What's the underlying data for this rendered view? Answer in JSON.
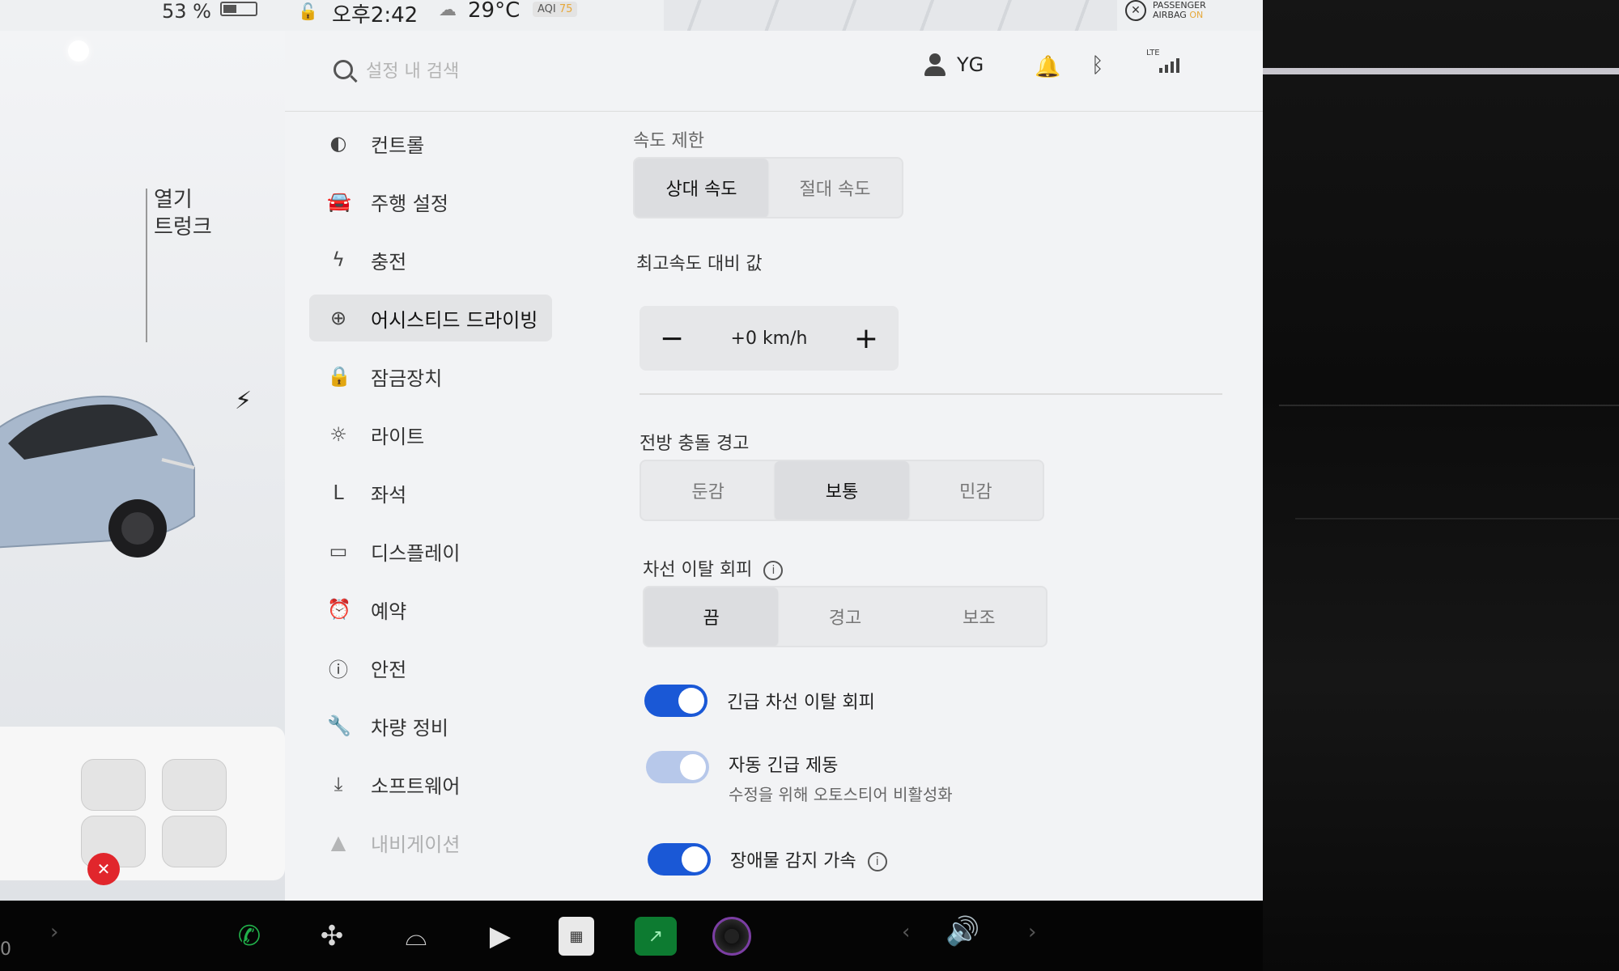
{
  "status_bar": {
    "battery_percent": "53 %",
    "time": "오후2:42",
    "temperature": "29°C",
    "aqi_label": "AQI",
    "aqi_value": "75",
    "airbag_line1": "PASSENGER",
    "airbag_line2": "AIRBAG",
    "airbag_state": "ON"
  },
  "car_panel": {
    "trunk_action": "열기",
    "trunk_label": "트렁크"
  },
  "topbar": {
    "search_placeholder": "설정 내 검색",
    "user_name": "YG",
    "network": "LTE"
  },
  "menu": {
    "items": [
      {
        "label": "컨트롤",
        "icon": "toggle-icon"
      },
      {
        "label": "주행 설정",
        "icon": "car-icon"
      },
      {
        "label": "충전",
        "icon": "lightning-icon"
      },
      {
        "label": "어시스티드 드라이빙",
        "icon": "steering-wheel-icon",
        "active": true
      },
      {
        "label": "잠금장치",
        "icon": "lock-icon"
      },
      {
        "label": "라이트",
        "icon": "light-icon"
      },
      {
        "label": "좌석",
        "icon": "seat-icon"
      },
      {
        "label": "디스플레이",
        "icon": "display-icon"
      },
      {
        "label": "예약",
        "icon": "alarm-icon"
      },
      {
        "label": "안전",
        "icon": "safety-icon"
      },
      {
        "label": "차량 정비",
        "icon": "wrench-icon"
      },
      {
        "label": "소프트웨어",
        "icon": "download-icon"
      },
      {
        "label": "내비게이션",
        "icon": "navigation-icon"
      }
    ]
  },
  "content": {
    "speed_limit": {
      "label": "속도 제한",
      "options": [
        "상대 속도",
        "절대 속도"
      ],
      "selected": "상대 속도"
    },
    "offset": {
      "label": "최고속도 대비 값",
      "value": "+0 km/h",
      "minus": "−",
      "plus": "+"
    },
    "forward_collision": {
      "label": "전방 충돌 경고",
      "options": [
        "둔감",
        "보통",
        "민감"
      ],
      "selected": "보통"
    },
    "lane_departure": {
      "label": "차선 이탈 회피",
      "info": "i",
      "options": [
        "끔",
        "경고",
        "보조"
      ],
      "selected": "끔"
    },
    "emergency_lane": {
      "label": "긴급 차선 이탈 회피",
      "enabled": true
    },
    "auto_emergency_brake": {
      "label": "자동 긴급 제동",
      "sub": "수정을 위해 오토스티어 비활성화",
      "enabled": true,
      "disabled": true
    },
    "obstacle_accel": {
      "label": "장애물 감지 가속",
      "info": "i",
      "enabled": true
    }
  },
  "dock": {
    "left_text": "0",
    "icons": [
      "phone-icon",
      "fan-icon",
      "wiper-icon",
      "media-player-icon",
      "apps-icon",
      "stocks-icon",
      "camera-icon"
    ],
    "volume_icon": "volume-icon"
  },
  "colors": {
    "accent": "#1a58d6",
    "accent_disabled": "#b7c8ea",
    "panel_bg": "#f2f3f5",
    "warning": "#e1262c"
  }
}
